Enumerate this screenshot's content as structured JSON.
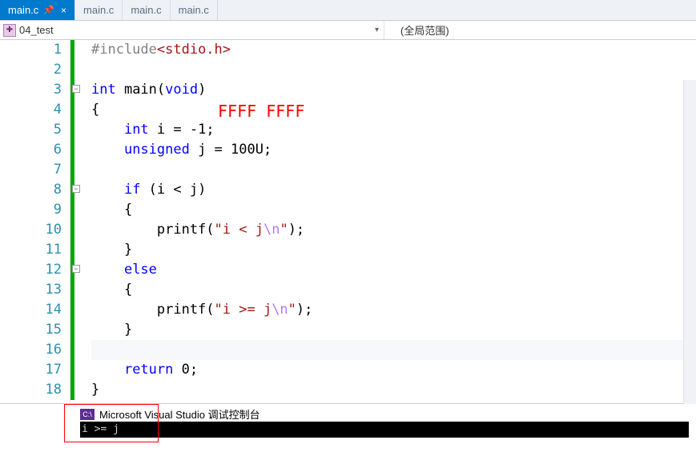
{
  "tabs": {
    "active": {
      "label": "main.c",
      "closeGlyph": "×"
    },
    "pinGlyph": "📌",
    "others": [
      {
        "label": "main.c"
      },
      {
        "label": "main.c"
      },
      {
        "label": "main.c"
      }
    ]
  },
  "navbar": {
    "iconLabel": "04_test",
    "scope": "(全局范围)",
    "dropdownGlyph": "▾"
  },
  "lineNumbers": [
    "1",
    "2",
    "3",
    "4",
    "5",
    "6",
    "7",
    "8",
    "9",
    "10",
    "11",
    "12",
    "13",
    "14",
    "15",
    "16",
    "17",
    "18"
  ],
  "annotations": {
    "ffff": "FFFF FFFF"
  },
  "code": {
    "l1_pre": "#include",
    "l1_inc": "<stdio.h>",
    "l3_kw1": "int",
    "l3_name": " main(",
    "l3_kw2": "void",
    "l3_close": ")",
    "l4": "{",
    "l5_indent": "    ",
    "l5_kw": "int",
    "l5_rest": " i = -1;",
    "l6_indent": "    ",
    "l6_kw": "unsigned",
    "l6_rest": " j = 100U;",
    "l8_indent": "    ",
    "l8_kw": "if",
    "l8_rest": " (i < j)",
    "l9": "    {",
    "l10_indent": "        printf(",
    "l10_str1": "\"i < j",
    "l10_esc": "\\n",
    "l10_str2": "\"",
    "l10_end": ");",
    "l11": "    }",
    "l12_indent": "    ",
    "l12_kw": "else",
    "l13": "    {",
    "l14_indent": "        printf(",
    "l14_str1": "\"i >= j",
    "l14_esc": "\\n",
    "l14_str2": "\"",
    "l14_end": ");",
    "l15": "    }",
    "l17_indent": "    ",
    "l17_kw": "return",
    "l17_rest": " 0;",
    "l18": "}"
  },
  "folds": {
    "minusGlyph": "−"
  },
  "console": {
    "iconText": "C:\\",
    "title": "Microsoft Visual Studio 调试控制台",
    "output": "i >= j"
  }
}
